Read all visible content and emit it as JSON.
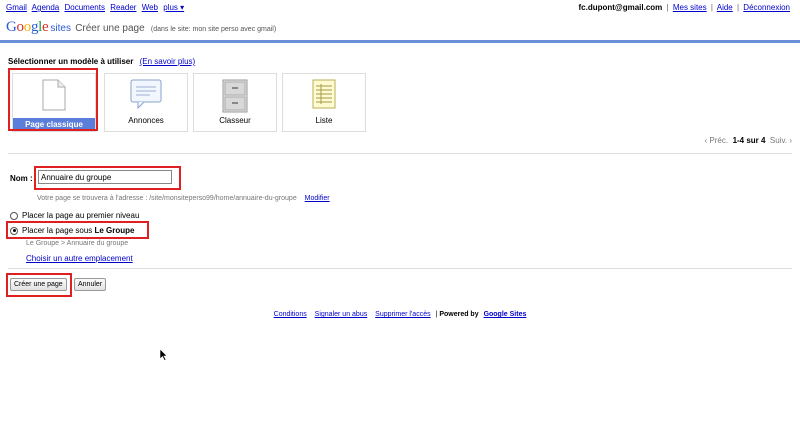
{
  "topnav": {
    "items": [
      "Gmail",
      "Agenda",
      "Documents",
      "Reader",
      "Web",
      "plus ▾"
    ]
  },
  "account": {
    "email": "fc.dupont@gmail.com",
    "links": [
      "Mes sites",
      "Aide",
      "Déconnexion"
    ]
  },
  "header": {
    "logo": "Google",
    "product": "sites",
    "page_title": "Créer une page",
    "site_note": "(dans le site: mon site perso avec gmail)"
  },
  "templates": {
    "heading": "Sélectionner un modèle à utiliser",
    "learn_more": "(En savoir plus)",
    "items": [
      {
        "label": "Page classique",
        "icon": "page-icon",
        "selected": true
      },
      {
        "label": "Annonces",
        "icon": "announcement-icon",
        "selected": false
      },
      {
        "label": "Classeur",
        "icon": "file-cabinet-icon",
        "selected": false
      },
      {
        "label": "Liste",
        "icon": "list-icon",
        "selected": false
      }
    ]
  },
  "pager": {
    "prev": "‹ Préc.",
    "range": "1-4 sur 4",
    "next": "Suiv. ›"
  },
  "form": {
    "name_label": "Nom :",
    "name_value": "Annuaire du groupe",
    "address_text": "Votre page se trouvera à l'adresse :  /site/monsiteperso99/home/annuaire-du-groupe",
    "modify_link": "Modifier",
    "option_top_level": "Placer la page au premier niveau",
    "option_under_prefix": "Placer la page sous",
    "option_under_parent": "Le Groupe",
    "selected_option": "under",
    "breadcrumb": "Le Groupe > Annuaire du groupe",
    "other_location": "Choisir un autre emplacement"
  },
  "buttons": {
    "create": "Créer une page",
    "cancel": "Annuler"
  },
  "footer": {
    "links": [
      "Conditions",
      "Signaler un abus",
      "Supprimer l'accès"
    ],
    "powered_prefix": "Powered by",
    "powered_link": "Google Sites"
  },
  "colors": {
    "accent_blue": "#6b90da",
    "selected_tile": "#5a7ed9",
    "highlight_red": "#e02020",
    "link": "#0000cc"
  }
}
